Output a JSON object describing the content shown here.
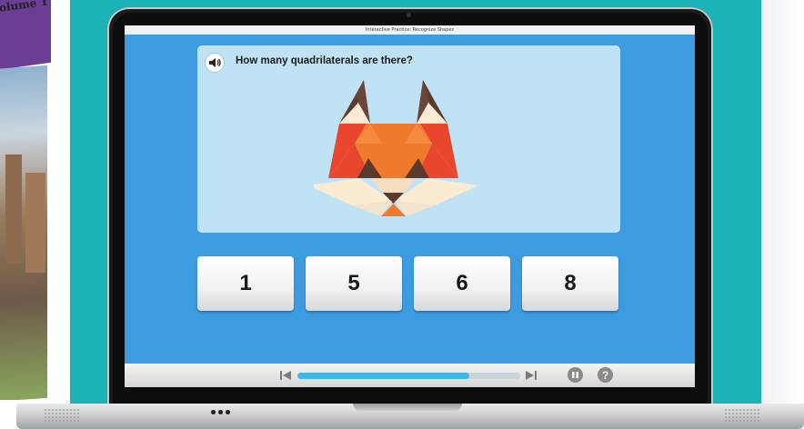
{
  "book": {
    "cover_text": "olume 1"
  },
  "app": {
    "window_title": "Interactive Practice: Recognize Shapes"
  },
  "question": {
    "text": "How many quadrilaterals are there?"
  },
  "answers": [
    {
      "label": "1"
    },
    {
      "label": "5"
    },
    {
      "label": "6"
    },
    {
      "label": "8"
    }
  ],
  "player": {
    "progress_fraction": 0.77
  },
  "colors": {
    "teal_background": "#1ab3b8",
    "screen_blue": "#3d9be0",
    "question_card": "#bfe3f4",
    "progress_fill": "#3fb8e8",
    "fox_orange": "#f07a2c",
    "fox_red": "#e8472e",
    "fox_brown": "#5a3b2e",
    "fox_cream": "#fbebd3"
  },
  "icons": [
    "speaker-icon",
    "skip-back-icon",
    "skip-forward-icon",
    "pause-icon",
    "help-icon"
  ]
}
